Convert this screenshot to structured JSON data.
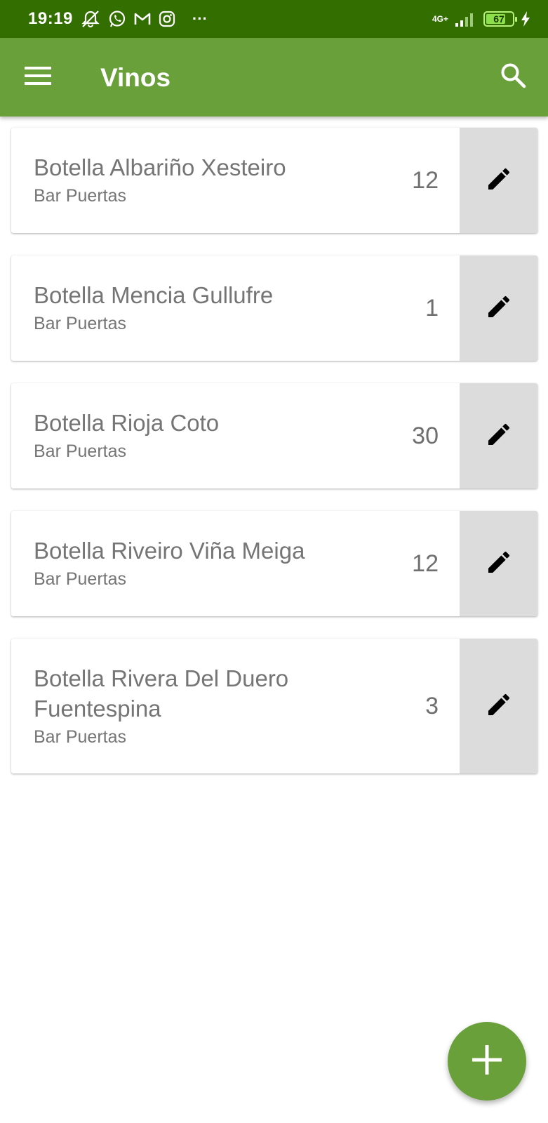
{
  "status_bar": {
    "time": "19:19",
    "network": "4G+",
    "battery_level": "67",
    "more": "···",
    "icons": [
      "muted-alarm-icon",
      "whatsapp-icon",
      "gmail-icon",
      "instagram-icon",
      "signal-icon",
      "charging-icon"
    ]
  },
  "app_bar": {
    "title": "Vinos",
    "background": "#6aa03a",
    "icons": [
      "hamburger-menu-icon",
      "search-icon"
    ]
  },
  "wines": [
    {
      "name": "Botella Albariño  Xesteiro",
      "place": "Bar Puertas",
      "quantity": "12"
    },
    {
      "name": "Botella Mencia Gullufre",
      "place": "Bar Puertas",
      "quantity": "1"
    },
    {
      "name": "Botella Rioja Coto",
      "place": "Bar Puertas",
      "quantity": "30"
    },
    {
      "name": "Botella Riveiro Viña Meiga",
      "place": "Bar Puertas",
      "quantity": "12"
    },
    {
      "name": "Botella Rivera Del Duero Fuentespina",
      "place": "Bar Puertas",
      "quantity": "3"
    }
  ],
  "fab": {
    "icon": "plus-icon",
    "color": "#6aa03a"
  },
  "colors": {
    "status_bar": "#336e00",
    "edit_panel": "#dcdcdc",
    "text_secondary": "#757575"
  }
}
